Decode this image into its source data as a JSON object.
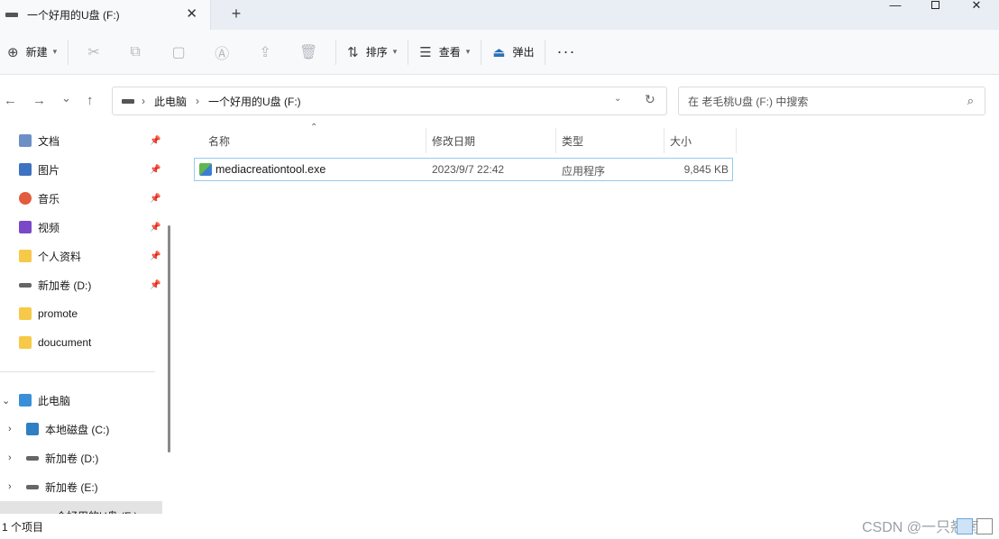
{
  "tab": {
    "title": "一个好用的U盘 (F:)",
    "close": "✕",
    "new_tab": "+"
  },
  "window_controls": {
    "minimize": "—",
    "close": "✕"
  },
  "toolbar": {
    "new_label": "新建",
    "sort_label": "排序",
    "view_label": "查看",
    "eject_label": "弹出",
    "more": "···"
  },
  "nav": {
    "back": "←",
    "forward": "→",
    "recent": "⌄",
    "up": "↑"
  },
  "address": {
    "crumbs": [
      "此电脑",
      "一个好用的U盘 (F:)"
    ],
    "search_placeholder": "在 老毛桃U盘 (F:) 中搜索"
  },
  "sidebar": {
    "quick_access": [
      {
        "label": "文档",
        "icon": "documents-icon",
        "pinned": true
      },
      {
        "label": "图片",
        "icon": "pictures-icon",
        "pinned": true
      },
      {
        "label": "音乐",
        "icon": "music-icon",
        "pinned": true
      },
      {
        "label": "视频",
        "icon": "videos-icon",
        "pinned": true
      },
      {
        "label": "个人资料",
        "icon": "folder-icon",
        "pinned": true
      },
      {
        "label": "新加卷 (D:)",
        "icon": "drive-icon",
        "pinned": true
      },
      {
        "label": "promote",
        "icon": "folder-icon",
        "pinned": false
      },
      {
        "label": "doucument",
        "icon": "folder-icon",
        "pinned": false
      }
    ],
    "this_pc": {
      "label": "此电脑",
      "icon": "pc-icon"
    },
    "drives": [
      {
        "label": "本地磁盘 (C:)",
        "icon": "windows-drive-icon"
      },
      {
        "label": "新加卷 (D:)",
        "icon": "drive-icon"
      },
      {
        "label": "新加卷 (E:)",
        "icon": "drive-icon"
      }
    ]
  },
  "columns": {
    "name": "名称",
    "modified": "修改日期",
    "type": "类型",
    "size": "大小"
  },
  "files": [
    {
      "name": "mediacreationtool.exe",
      "modified": "2023/9/7 22:42",
      "type": "应用程序",
      "size": "9,845 KB"
    }
  ],
  "status": {
    "count": "1 个项目",
    "watermark": "CSDN @一只翘南"
  }
}
